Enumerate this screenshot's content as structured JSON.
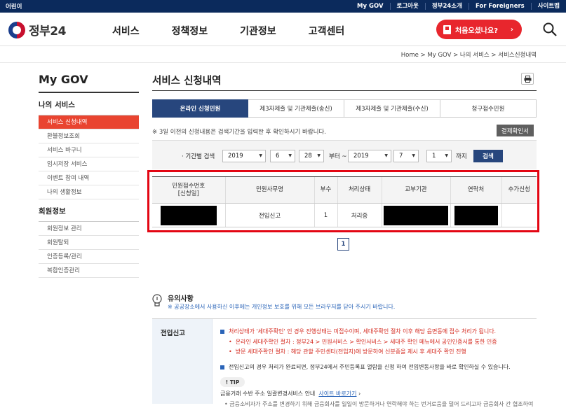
{
  "topbar": {
    "left": "어린이",
    "links": [
      "My GOV",
      "로그아웃",
      "정부24소개",
      "For Foreigners",
      "사이트맵"
    ]
  },
  "header": {
    "logo_text": "정부24",
    "nav": [
      "서비스",
      "정책정보",
      "기관정보",
      "고객센터"
    ],
    "first_visit_label": "처음오셨나요?",
    "first_visit_arrow": "›"
  },
  "breadcrumb": "Home  >  My GOV  >  나의 서비스  >  서비스신청내역",
  "sidebar": {
    "title": "My GOV",
    "section1": "나의 서비스",
    "items1": [
      "서비스 신청내역",
      "환불정보조회",
      "서비스 바구니",
      "임시저장 서비스",
      "이벤트 참여 내역",
      "나의 생활정보"
    ],
    "section2": "회원정보",
    "items2": [
      "회원정보 관리",
      "회원탈퇴",
      "인증등록/관리",
      "복합인증관리"
    ]
  },
  "main": {
    "title": "서비스 신청내역",
    "tabs": [
      "온라인 신청민원",
      "제3자제출 및 기관제출(송신)",
      "제3자제출 및 기관제출(수신)",
      "청구접수민원"
    ],
    "note": "※ 3일 이전의 신청내용은 검색기간을 입력한 후 확인하시기 바랍니다.",
    "receipt_button": "결제확인서",
    "search": {
      "label": "· 기간별 검색",
      "from_year": "2019",
      "from_month": "6",
      "from_day": "28",
      "from_text": "부터 ~",
      "to_year": "2019",
      "to_month": "7",
      "to_day": "1",
      "to_text": "까지",
      "button": "검색"
    },
    "table": {
      "headers": [
        "민원접수번호\n[신청일]",
        "민원사무명",
        "부수",
        "처리상태",
        "교부기관",
        "연락처",
        "추가신청"
      ],
      "row": [
        "",
        "전입신고",
        "1",
        "처리중",
        "",
        "",
        ""
      ]
    },
    "page": "1"
  },
  "caution": {
    "title": "유의사항",
    "sub": "※ 공공장소에서 사용하신 이후에는 개인정보 보호를 위해 모든 브라우저를 닫아 주시기 바랍니다."
  },
  "info": {
    "label": "전입신고",
    "line1": "처리상태가 '세대주확인' 인 경우 진행상태는 미접수이며, 세대주확인 절차 이후 해당 읍면동에 접수 처리가 됩니다.",
    "line2": "온라인 세대주확인 절차 : 정부24 > 민원서비스 > 확인서비스 > 세대주 확인 메뉴에서 공인인증서를 통한 인증",
    "line3": "방문 세대주확인 절차 : 해당 관할 주민센터(전입지)에 방문하여 신분증을 제시 후 세대주 확인 진행",
    "line4": "전입신고의 경우 처리가 완료되면, 정부24에서 주민등록표 열람을 신청 하여 전입변동사항을 바로 확인하실 수 있습니다.",
    "tip": "TIP",
    "line5": "금융거래 수반 주소 일괄변경서비스 안내",
    "link": "사이트 바로가기",
    "line6": "• 금융소비자가 주소를 변경하기 위해 금융회사를 일일이 방문하거나 연락해야 하는 번거로움을 덜어 드리고자 금융회사 간 협조하여"
  }
}
